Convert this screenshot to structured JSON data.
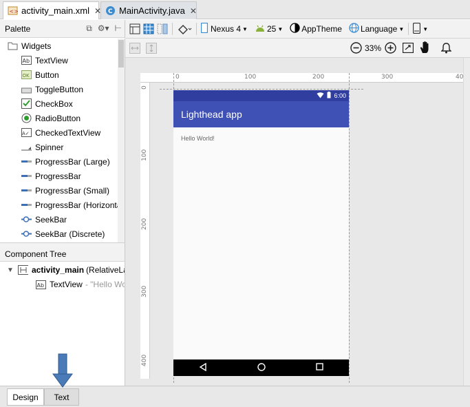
{
  "tabs": [
    {
      "label": "activity_main.xml",
      "icon": "xml-file-icon",
      "active": true
    },
    {
      "label": "MainActivity.java",
      "icon": "class-file-icon",
      "active": false
    }
  ],
  "palette": {
    "title": "Palette",
    "group": "Widgets",
    "items": [
      "TextView",
      "Button",
      "ToggleButton",
      "CheckBox",
      "RadioButton",
      "CheckedTextView",
      "Spinner",
      "ProgressBar (Large)",
      "ProgressBar",
      "ProgressBar (Small)",
      "ProgressBar (Horizontal)",
      "SeekBar",
      "SeekBar (Discrete)"
    ]
  },
  "component_tree": {
    "title": "Component Tree",
    "root_name": "activity_main",
    "root_type": "(RelativeLa",
    "child_name": "TextView",
    "child_text": "- \"Hello Wo"
  },
  "toolbar": {
    "device": "Nexus 4",
    "api": "25",
    "theme": "AppTheme",
    "language": "Language",
    "zoom": "33%"
  },
  "rulers": {
    "top": [
      "0",
      "100",
      "200",
      "300",
      "40"
    ],
    "left": [
      "0",
      "100",
      "200",
      "300",
      "400"
    ]
  },
  "preview": {
    "time": "6:00",
    "app_title": "Lighthead app",
    "hello": "Hello World!"
  },
  "bottom_tabs": {
    "design": "Design",
    "text": "Text"
  },
  "colors": {
    "primary": "#3f51b5",
    "primary_dark": "#303f9f",
    "arrow": "#4a7ab8"
  }
}
